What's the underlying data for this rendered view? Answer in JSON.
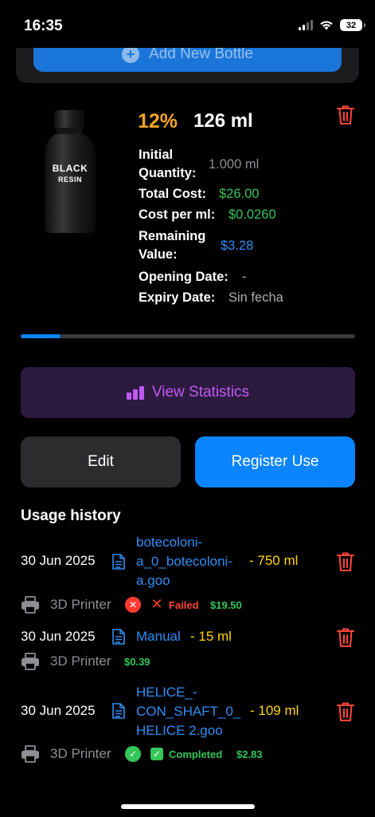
{
  "status_bar": {
    "time": "16:35",
    "battery": "32"
  },
  "top_action": {
    "label": "Add New Bottle"
  },
  "bottle": {
    "label_line1": "BLACK",
    "label_line2": "RESIN",
    "percent": "12%",
    "percent_value": 12,
    "remaining": "126 ml",
    "info": {
      "initial_quantity_label_1": "Initial",
      "initial_quantity_label_2": "Quantity:",
      "initial_quantity_value": "1.000 ml",
      "total_cost_label": "Total Cost:",
      "total_cost_value": "$26.00",
      "cost_per_ml_label": "Cost per ml:",
      "cost_per_ml_value": "$0.0260",
      "remaining_value_label_1": "Remaining",
      "remaining_value_label_2": "Value:",
      "remaining_value_value": "$3.28",
      "opening_date_label": "Opening Date:",
      "opening_date_value": "-",
      "expiry_date_label": "Expiry Date:",
      "expiry_date_value": "Sin fecha"
    }
  },
  "actions": {
    "view_statistics": "View Statistics",
    "edit": "Edit",
    "register_use": "Register Use"
  },
  "history": {
    "title": "Usage history",
    "entries": [
      {
        "date": "30 Jun 2025",
        "file_lines": [
          "botecoloni-",
          "a_0_botecoloni-",
          "a.goo"
        ],
        "amount": "- 750 ml",
        "type": "3D Printer",
        "status": "Failed",
        "cost": "$19.50"
      },
      {
        "date": "30 Jun 2025",
        "file_lines": [
          "Manual"
        ],
        "amount": "- 15 ml",
        "type": "3D Printer",
        "cost": "$0.39"
      },
      {
        "date": "30 Jun 2025",
        "file_lines": [
          "HELICE_-",
          "CON_SHAFT_0_",
          "HELICE 2.goo"
        ],
        "amount": "- 109 ml",
        "type": "3D Printer",
        "status": "Completed",
        "cost": "$2.83"
      }
    ]
  },
  "colors": {
    "accent_blue": "#0a84ff",
    "percent_orange": "#f5a623",
    "delete_red": "#ff453a",
    "money_green": "#34c759",
    "amount_yellow": "#ffd60a",
    "stats_purple": "#bf5af2"
  }
}
